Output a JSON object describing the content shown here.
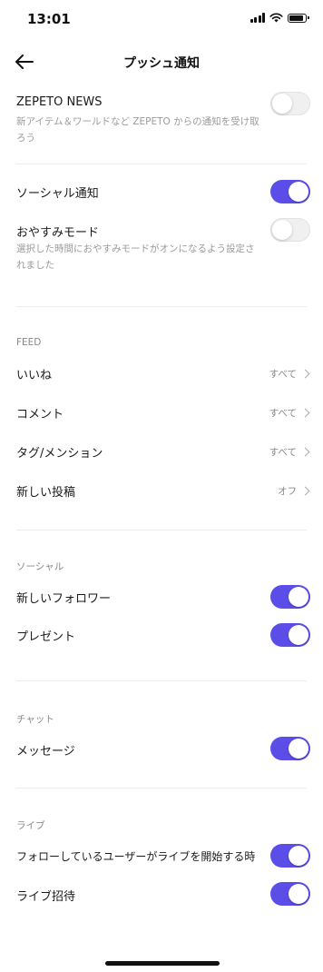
{
  "status_bar": {
    "time": "13:01"
  },
  "header": {
    "title": "プッシュ通知"
  },
  "zepeto_news": {
    "label": "ZEPETO NEWS",
    "description": "新アイテム＆ワールドなど ZEPETO からの通知を受け取ろう",
    "enabled": false
  },
  "social_notification": {
    "label": "ソーシャル通知",
    "enabled": true
  },
  "sleep_mode": {
    "label": "おやすみモード",
    "description": "選択した時間におやすみモードがオンになるよう設定されました",
    "enabled": false
  },
  "feed": {
    "header": "FEED",
    "items": [
      {
        "label": "いいね",
        "value": "すべて"
      },
      {
        "label": "コメント",
        "value": "すべて"
      },
      {
        "label": "タグ/メンション",
        "value": "すべて"
      },
      {
        "label": "新しい投稿",
        "value": "オフ"
      }
    ]
  },
  "social": {
    "header": "ソーシャル",
    "items": [
      {
        "label": "新しいフォロワー",
        "enabled": true
      },
      {
        "label": "プレゼント",
        "enabled": true
      }
    ]
  },
  "chat": {
    "header": "チャット",
    "items": [
      {
        "label": "メッセージ",
        "enabled": true
      }
    ]
  },
  "live": {
    "header": "ライブ",
    "items": [
      {
        "label": "フォローしているユーザーがライブを開始する時",
        "enabled": true
      },
      {
        "label": "ライブ招待",
        "enabled": true
      }
    ]
  },
  "colors": {
    "accent": "#5b4de8",
    "toggle_off": "#f0f0f0",
    "secondary_text": "#9a9a9a"
  }
}
